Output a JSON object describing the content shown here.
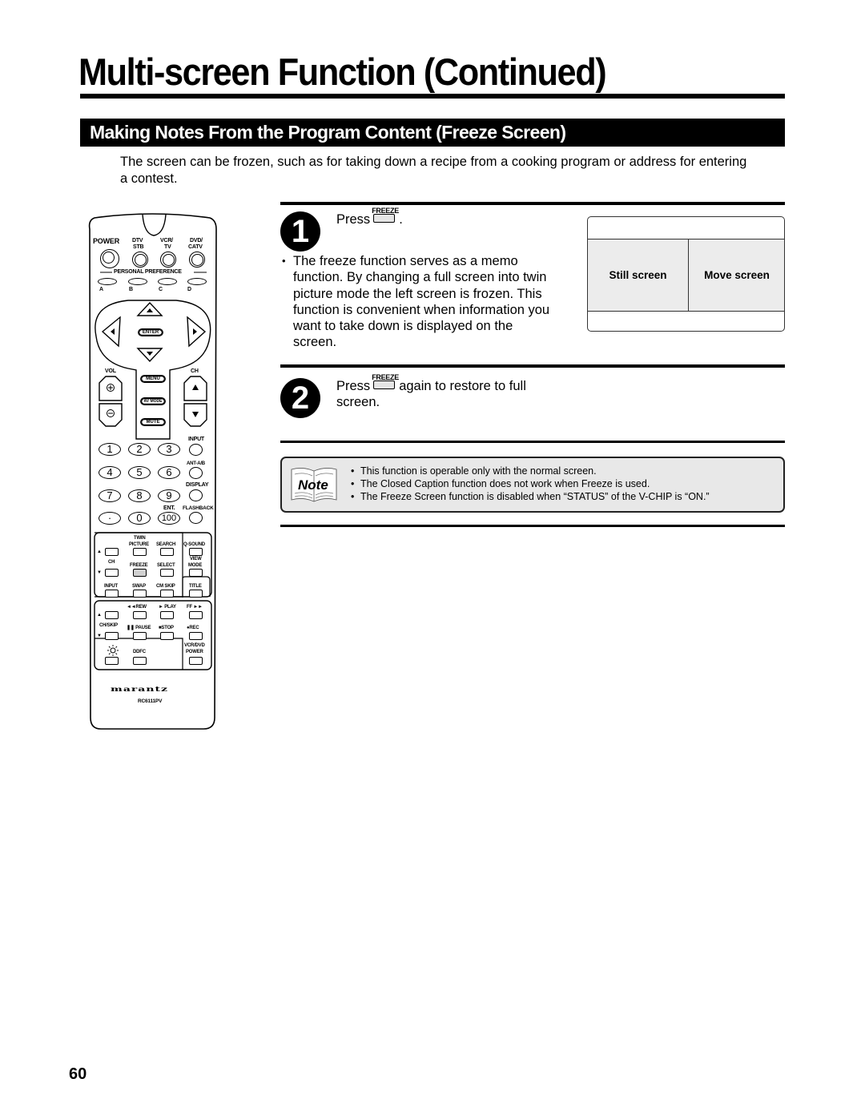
{
  "page": {
    "title": "Multi-screen Function (Continued)",
    "section_title": "Making Notes From the Program Content (Freeze Screen)",
    "intro": "The screen can be frozen, such as for taking down a recipe from a cooking program or address for entering a contest.",
    "page_number": "60"
  },
  "steps": [
    {
      "number": "1",
      "press_label": "Press",
      "key_label": "FREEZE",
      "after_key": ".",
      "bullets": [
        "The freeze function serves as a memo function. By changing a full screen into twin picture mode the left screen is frozen. This function is convenient when information you want to take down is displayed on the screen."
      ]
    },
    {
      "number": "2",
      "press_label": "Press",
      "key_label": "FREEZE",
      "after_key": "again to restore to full",
      "line2": "screen."
    }
  ],
  "screen_diagram": {
    "left_label": "Still screen",
    "right_label": "Move screen"
  },
  "note": {
    "label": "Note",
    "items": [
      "This function is operable only with the normal screen.",
      "The Closed Caption function does not work when Freeze is used.",
      "The Freeze Screen function is disabled when “STATUS” of the V-CHIP is “ON.”"
    ]
  },
  "remote": {
    "brand": "marantz",
    "model": "RC6111PV",
    "top_row": {
      "power": "POWER",
      "dtv": "DTV",
      "stb": "STB",
      "vcr": "VCR/",
      "tv": "TV",
      "dvd": "DVD/",
      "catv": "CATV"
    },
    "personal_preference": "PERSONAL PREFERENCE",
    "pref_buttons": [
      "A",
      "B",
      "C",
      "D"
    ],
    "nav": {
      "enter": "ENTER",
      "menu": "MENU",
      "av_mode": "AV MODE",
      "mute": "MUTE",
      "vol": "VOL",
      "ch": "CH"
    },
    "numbers": [
      "1",
      "2",
      "3",
      "4",
      "5",
      "6",
      "7",
      "8",
      "9",
      "·",
      "0",
      "100"
    ],
    "side_labels": {
      "input": "INPUT",
      "ant": "ANT-A/B",
      "display": "DISPLAY",
      "ent": "ENT.",
      "flashback": "FLASHBACK"
    },
    "lower": {
      "twin": "TWIN",
      "picture": "PICTURE",
      "search": "SEARCH",
      "qsound": "Q-SOUND",
      "ch": "CH",
      "freeze": "FREEZE",
      "select": "SELECT",
      "view": "VIEW",
      "mode": "MODE",
      "input": "INPUT",
      "swap": "SWAP",
      "cmskip": "CM SKIP",
      "title": "TITLE",
      "rew": "◄◄REW",
      "play": "► PLAY",
      "ff": "FF ►►",
      "chskip": "CH/SKIP",
      "pause": "❚❚ PAUSE",
      "stop": "■STOP",
      "rec": "●REC",
      "ddfc": "DDFC",
      "vcrdvd": "VCR/DVD",
      "power": "POWER"
    }
  }
}
